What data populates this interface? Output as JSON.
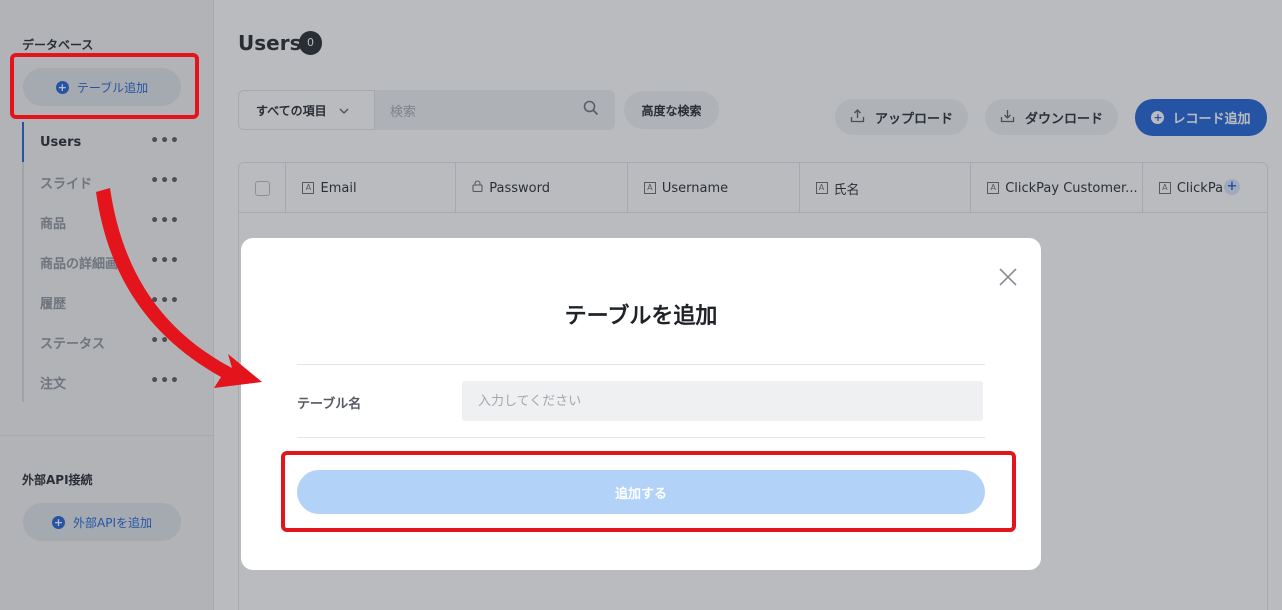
{
  "sidebar": {
    "database_title": "データベース",
    "add_table_label": "テーブル追加",
    "tables": [
      {
        "label": "Users",
        "more": "•••"
      },
      {
        "label": "スライド",
        "more": "•••"
      },
      {
        "label": "商品",
        "more": "•••"
      },
      {
        "label": "商品の詳細画像",
        "more": "•••"
      },
      {
        "label": "履歴",
        "more": "•••"
      },
      {
        "label": "ステータス",
        "more": "•••"
      },
      {
        "label": "注文",
        "more": "•••"
      }
    ],
    "api_title": "外部API接続",
    "add_api_label": "外部APIを追加"
  },
  "main": {
    "title": "Users",
    "count": "0",
    "filter_label": "すべての項目",
    "search_placeholder": "検索",
    "advanced_search": "高度な検索",
    "upload": "アップロード",
    "download": "ダウンロード",
    "add_record": "レコード追加",
    "columns": [
      {
        "icon": "A",
        "label": "Email"
      },
      {
        "icon": "lock",
        "label": "Password"
      },
      {
        "icon": "A",
        "label": "Username"
      },
      {
        "icon": "A",
        "label": "氏名"
      },
      {
        "icon": "A",
        "label": "ClickPay Customer..."
      },
      {
        "icon": "A",
        "label": "ClickPa"
      }
    ]
  },
  "modal": {
    "title": "テーブルを追加",
    "field_label": "テーブル名",
    "field_placeholder": "入力してください",
    "field_value": "",
    "submit_label": "追加する"
  },
  "colors": {
    "accent": "#1a5fd8",
    "highlight": "#e3141b",
    "submit_disabled": "#b2d2f8"
  }
}
